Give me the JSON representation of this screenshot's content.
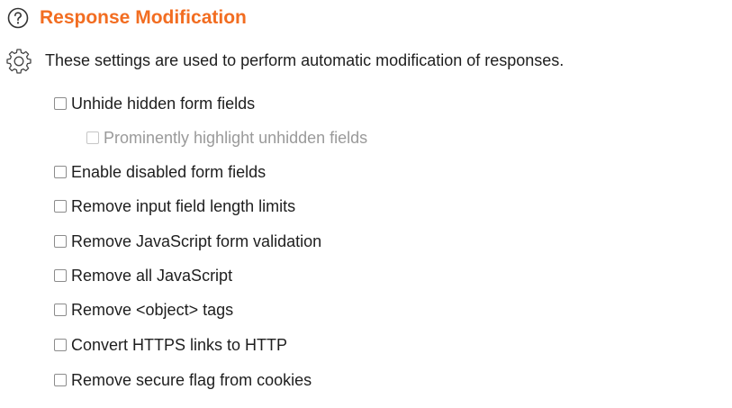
{
  "section": {
    "title": "Response Modification",
    "description": "These settings are used to perform automatic modification of responses.",
    "title_color": "#f26d21",
    "icons": [
      "help-circle-icon",
      "gear-icon"
    ]
  },
  "options": [
    {
      "label": "Unhide hidden form fields",
      "checked": false,
      "enabled": true
    },
    {
      "label": "Prominently highlight unhidden fields",
      "checked": false,
      "enabled": false
    },
    {
      "label": "Enable disabled form fields",
      "checked": false,
      "enabled": true
    },
    {
      "label": "Remove input field length limits",
      "checked": false,
      "enabled": true
    },
    {
      "label": "Remove JavaScript form validation",
      "checked": false,
      "enabled": true
    },
    {
      "label": "Remove all JavaScript",
      "checked": false,
      "enabled": true
    },
    {
      "label": "Remove <object> tags",
      "checked": false,
      "enabled": true
    },
    {
      "label": "Convert HTTPS links to HTTP",
      "checked": false,
      "enabled": true
    },
    {
      "label": "Remove secure flag from cookies",
      "checked": false,
      "enabled": true
    }
  ]
}
